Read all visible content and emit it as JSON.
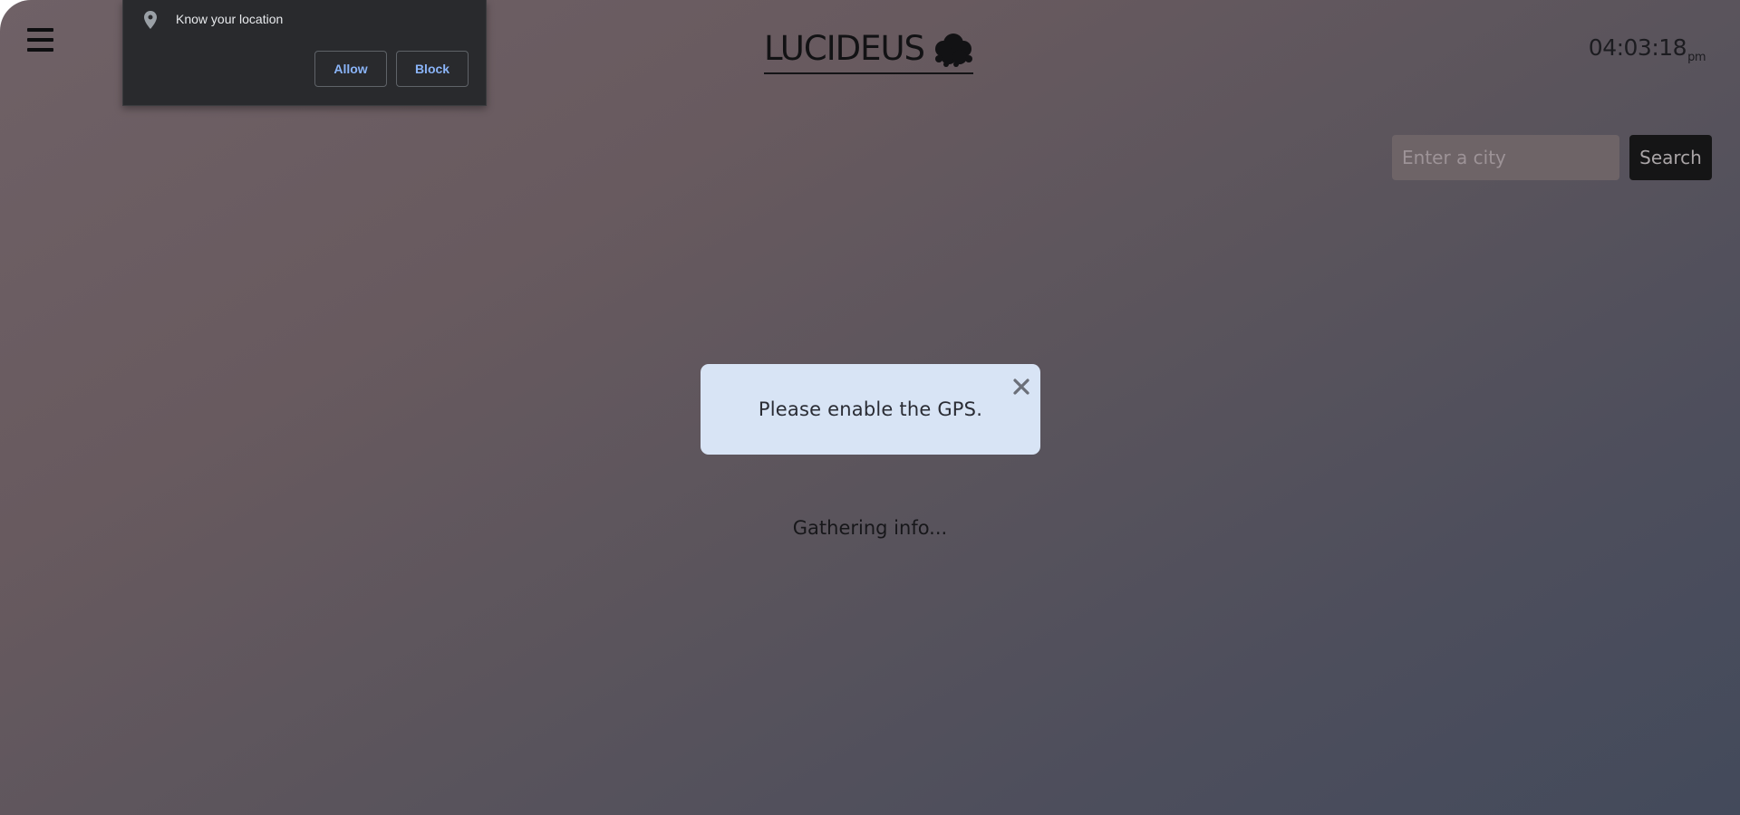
{
  "header": {
    "menu_icon": "hamburger-menu-icon",
    "logo_text": "LUCIDEUS",
    "logo_icon": "cloud-icon",
    "clock": {
      "time": "04:03:18",
      "suffix": "pm"
    }
  },
  "search": {
    "placeholder": "Enter a city",
    "value": "",
    "button_label": "Search"
  },
  "alert": {
    "message": "Please enable the GPS.",
    "close_icon": "close-icon"
  },
  "status_text": "Gathering info...",
  "permission_popup": {
    "icon": "location-pin-icon",
    "text": "Know your location",
    "allow_label": "Allow",
    "block_label": "Block"
  },
  "colors": {
    "alert_bg": "#d8e4f5",
    "button_bg": "#151516",
    "popup_bg": "#292a2d",
    "popup_link": "#8ab4f8"
  }
}
